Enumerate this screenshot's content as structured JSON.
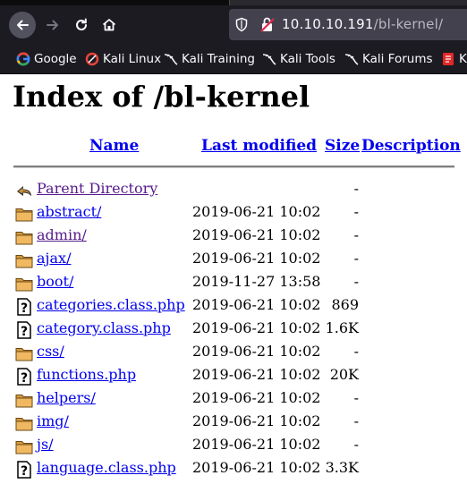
{
  "browser": {
    "url_host": "10.10.10.191",
    "url_path": "/bl-kernel/",
    "bookmarks": [
      "Google",
      "Kali Linux",
      "Kali Training",
      "Kali Tools",
      "Kali Forums",
      "K"
    ]
  },
  "page": {
    "title": "Index of /bl-kernel",
    "columns": {
      "name": "Name",
      "modified": "Last modified",
      "size": "Size",
      "description": "Description"
    },
    "entries": [
      {
        "name": "Parent Directory",
        "modified": "",
        "size": "-",
        "icon": "back-icon",
        "visited": true
      },
      {
        "name": "abstract/",
        "modified": "2019-06-21 10:02",
        "size": "-",
        "icon": "folder-icon",
        "visited": false
      },
      {
        "name": "admin/",
        "modified": "2019-06-21 10:02",
        "size": "-",
        "icon": "folder-icon",
        "visited": true
      },
      {
        "name": "ajax/",
        "modified": "2019-06-21 10:02",
        "size": "-",
        "icon": "folder-icon",
        "visited": false
      },
      {
        "name": "boot/",
        "modified": "2019-11-27 13:58",
        "size": "-",
        "icon": "folder-icon",
        "visited": false
      },
      {
        "name": "categories.class.php",
        "modified": "2019-06-21 10:02",
        "size": "869",
        "icon": "unknown-file-icon",
        "visited": false
      },
      {
        "name": "category.class.php",
        "modified": "2019-06-21 10:02",
        "size": "1.6K",
        "icon": "unknown-file-icon",
        "visited": false
      },
      {
        "name": "css/",
        "modified": "2019-06-21 10:02",
        "size": "-",
        "icon": "folder-icon",
        "visited": false
      },
      {
        "name": "functions.php",
        "modified": "2019-06-21 10:02",
        "size": "20K",
        "icon": "unknown-file-icon",
        "visited": false
      },
      {
        "name": "helpers/",
        "modified": "2019-06-21 10:02",
        "size": "-",
        "icon": "folder-icon",
        "visited": false
      },
      {
        "name": "img/",
        "modified": "2019-06-21 10:02",
        "size": "-",
        "icon": "folder-icon",
        "visited": false
      },
      {
        "name": "js/",
        "modified": "2019-06-21 10:02",
        "size": "-",
        "icon": "folder-icon",
        "visited": false
      },
      {
        "name": "language.class.php",
        "modified": "2019-06-21 10:02",
        "size": "3.3K",
        "icon": "unknown-file-icon",
        "visited": false
      }
    ]
  }
}
